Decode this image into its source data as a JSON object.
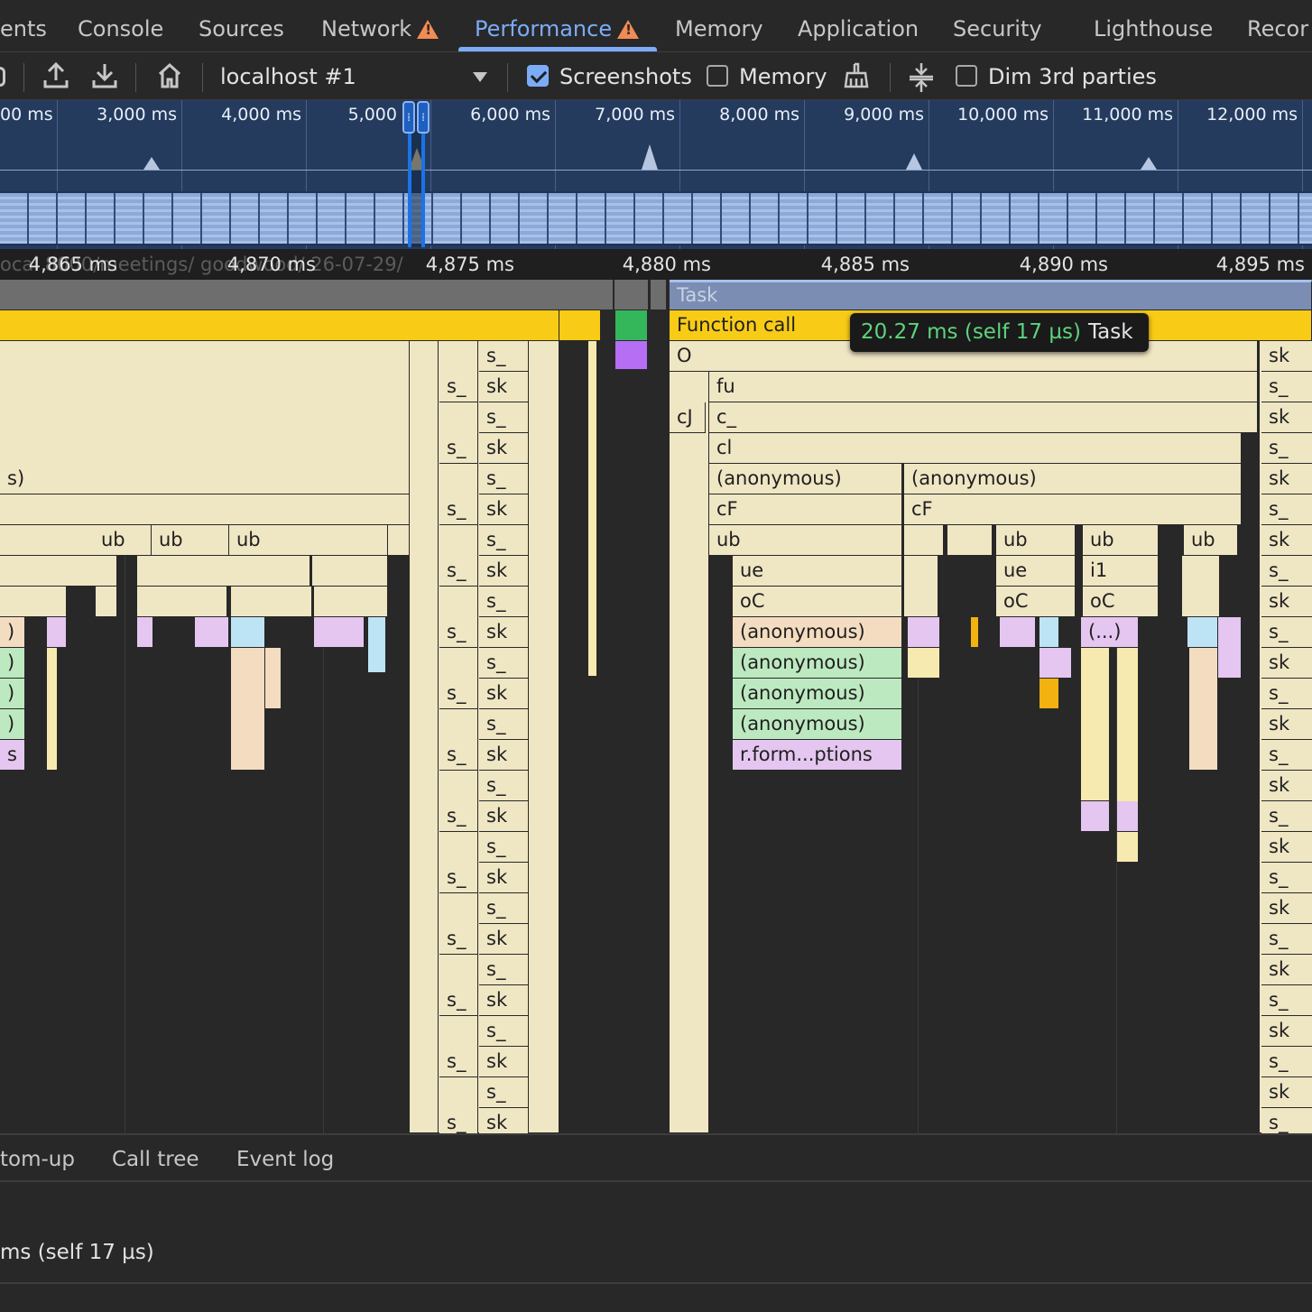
{
  "tabs": {
    "elements": "ents",
    "console": "Console",
    "sources": "Sources",
    "network": "Network",
    "performance": "Performance",
    "memory": "Memory",
    "application": "Application",
    "security": "Security",
    "lighthouse": "Lighthouse",
    "recorder": "Recor",
    "active": "Performance"
  },
  "toolbar": {
    "recording_select": "localhost #1",
    "screenshots_label": "Screenshots",
    "screenshots_checked": true,
    "memory_label": "Memory",
    "memory_checked": false,
    "dim_3rd_parties_label": "Dim 3rd parties",
    "dim_3rd_parties_checked": false
  },
  "overview": {
    "tick_labels": [
      "00 ms",
      "3,000 ms",
      "4,000 ms",
      "5,000",
      "6,000 ms",
      "7,000 ms",
      "8,000 ms",
      "9,000 ms",
      "10,000 ms",
      "11,000 ms",
      "12,000 ms"
    ]
  },
  "ruler": {
    "url_ghost": "ocal   8000/meetings/           goodwood/   26-07-29/",
    "tick_labels": [
      "4,865 ms",
      "4,870 ms",
      "4,875 ms",
      "4,880 ms",
      "4,885 ms",
      "4,890 ms",
      "4,895 ms"
    ]
  },
  "flame": {
    "task_label": "Task",
    "function_call_label": "Function call",
    "tooltip_time": "20.27 ms (self 17 µs)",
    "tooltip_name": "Task",
    "left_group": {
      "s": "s_",
      "sk": "sk",
      "ub": "ub",
      "s_paren": "s)",
      "paren": ")",
      "s_only": "s"
    },
    "main_stack": {
      "o": "O",
      "fu": "fu",
      "cj": "cJ",
      "c": "c_",
      "cl": "cl",
      "anon": "(anonymous)",
      "cf": "cF",
      "ub": "ub",
      "ue": "ue",
      "oc": "oC",
      "i1": "i1",
      "ellipsis": "(...)",
      "rform": "r.form...ptions"
    }
  },
  "bottom": {
    "tabs": [
      "tom-up",
      "Call tree",
      "Event log"
    ],
    "summary": "ms (self 17 µs)"
  },
  "colors": {
    "accent": "#7cacf8",
    "warning": "#f28b54",
    "task_yellow": "#f8cc16",
    "tooltip_green": "#5ed37d"
  }
}
